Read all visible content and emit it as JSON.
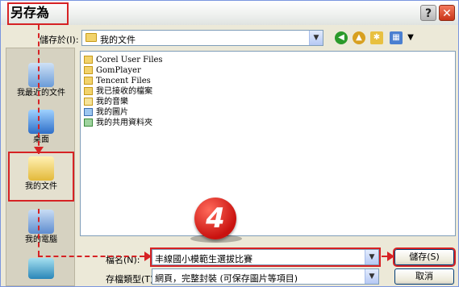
{
  "window": {
    "title": "另存為",
    "help_glyph": "?",
    "close_glyph": "✕"
  },
  "save_in": {
    "label": "儲存於(I):",
    "value": "我的文件"
  },
  "places": [
    {
      "id": "recent",
      "label": "我最近的文件"
    },
    {
      "id": "desktop",
      "label": "桌面"
    },
    {
      "id": "documents",
      "label": "我的文件"
    },
    {
      "id": "computer",
      "label": "我的電腦"
    },
    {
      "id": "network",
      "label": ""
    }
  ],
  "files": [
    {
      "name": "Corel User Files",
      "icon": "folder-icon"
    },
    {
      "name": "GomPlayer",
      "icon": "folder-icon"
    },
    {
      "name": "Tencent Files",
      "icon": "folder-icon"
    },
    {
      "name": "我已接收的檔案",
      "icon": "folder-icon"
    },
    {
      "name": "我的音樂",
      "icon": "music-folder-icon"
    },
    {
      "name": "我的圖片",
      "icon": "pictures-folder-icon"
    },
    {
      "name": "我的共用資料夾",
      "icon": "shared-folder-icon"
    }
  ],
  "filename": {
    "label": "檔名(N):",
    "value": "丰線國小模範生選拔比賽"
  },
  "filetype": {
    "label": "存檔類型(T):",
    "value": "網頁，完整封裝 (可保存圖片等項目)"
  },
  "buttons": {
    "save": "儲存(S)",
    "cancel": "取消"
  },
  "annotation": {
    "step_number": "4",
    "color": "#d62224"
  },
  "icons": {
    "dropdown": "▼",
    "back": "back-icon",
    "up": "up-folder-icon",
    "new_folder": "new-folder-icon",
    "views": "views-menu-icon"
  }
}
